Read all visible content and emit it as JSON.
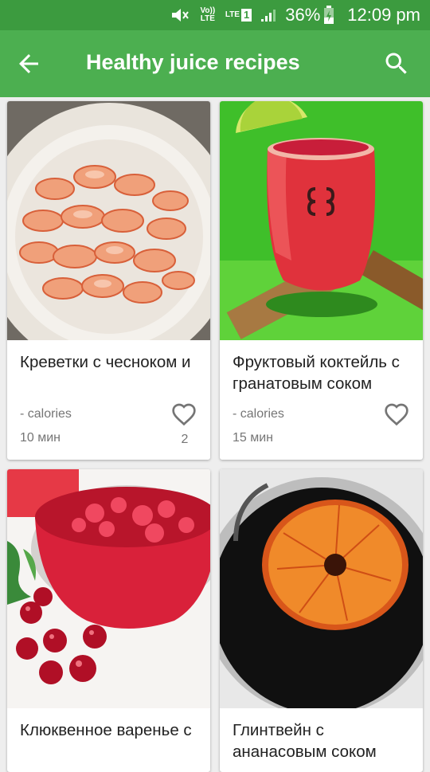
{
  "status_bar": {
    "volte": "Vo)) LTE",
    "lte": "LTE",
    "sim": "1",
    "battery": "36%",
    "time": "12:09 pm"
  },
  "app_bar": {
    "title": "Healthy juice recipes"
  },
  "colors": {
    "primary": "#4caf50",
    "primary_dark": "#3c9b3f"
  },
  "recipes": [
    {
      "title": "Креветки с чесноком и",
      "calories": "- calories",
      "time": "10 мин",
      "likes": "2"
    },
    {
      "title": "Фруктовый коктейль с гранатовым соком",
      "calories": "- calories",
      "time": "15 мин",
      "likes": ""
    },
    {
      "title": "Клюквенное варенье с",
      "calories": "",
      "time": "",
      "likes": ""
    },
    {
      "title": "Глинтвейн с ананасовым соком",
      "calories": "",
      "time": "",
      "likes": ""
    }
  ]
}
